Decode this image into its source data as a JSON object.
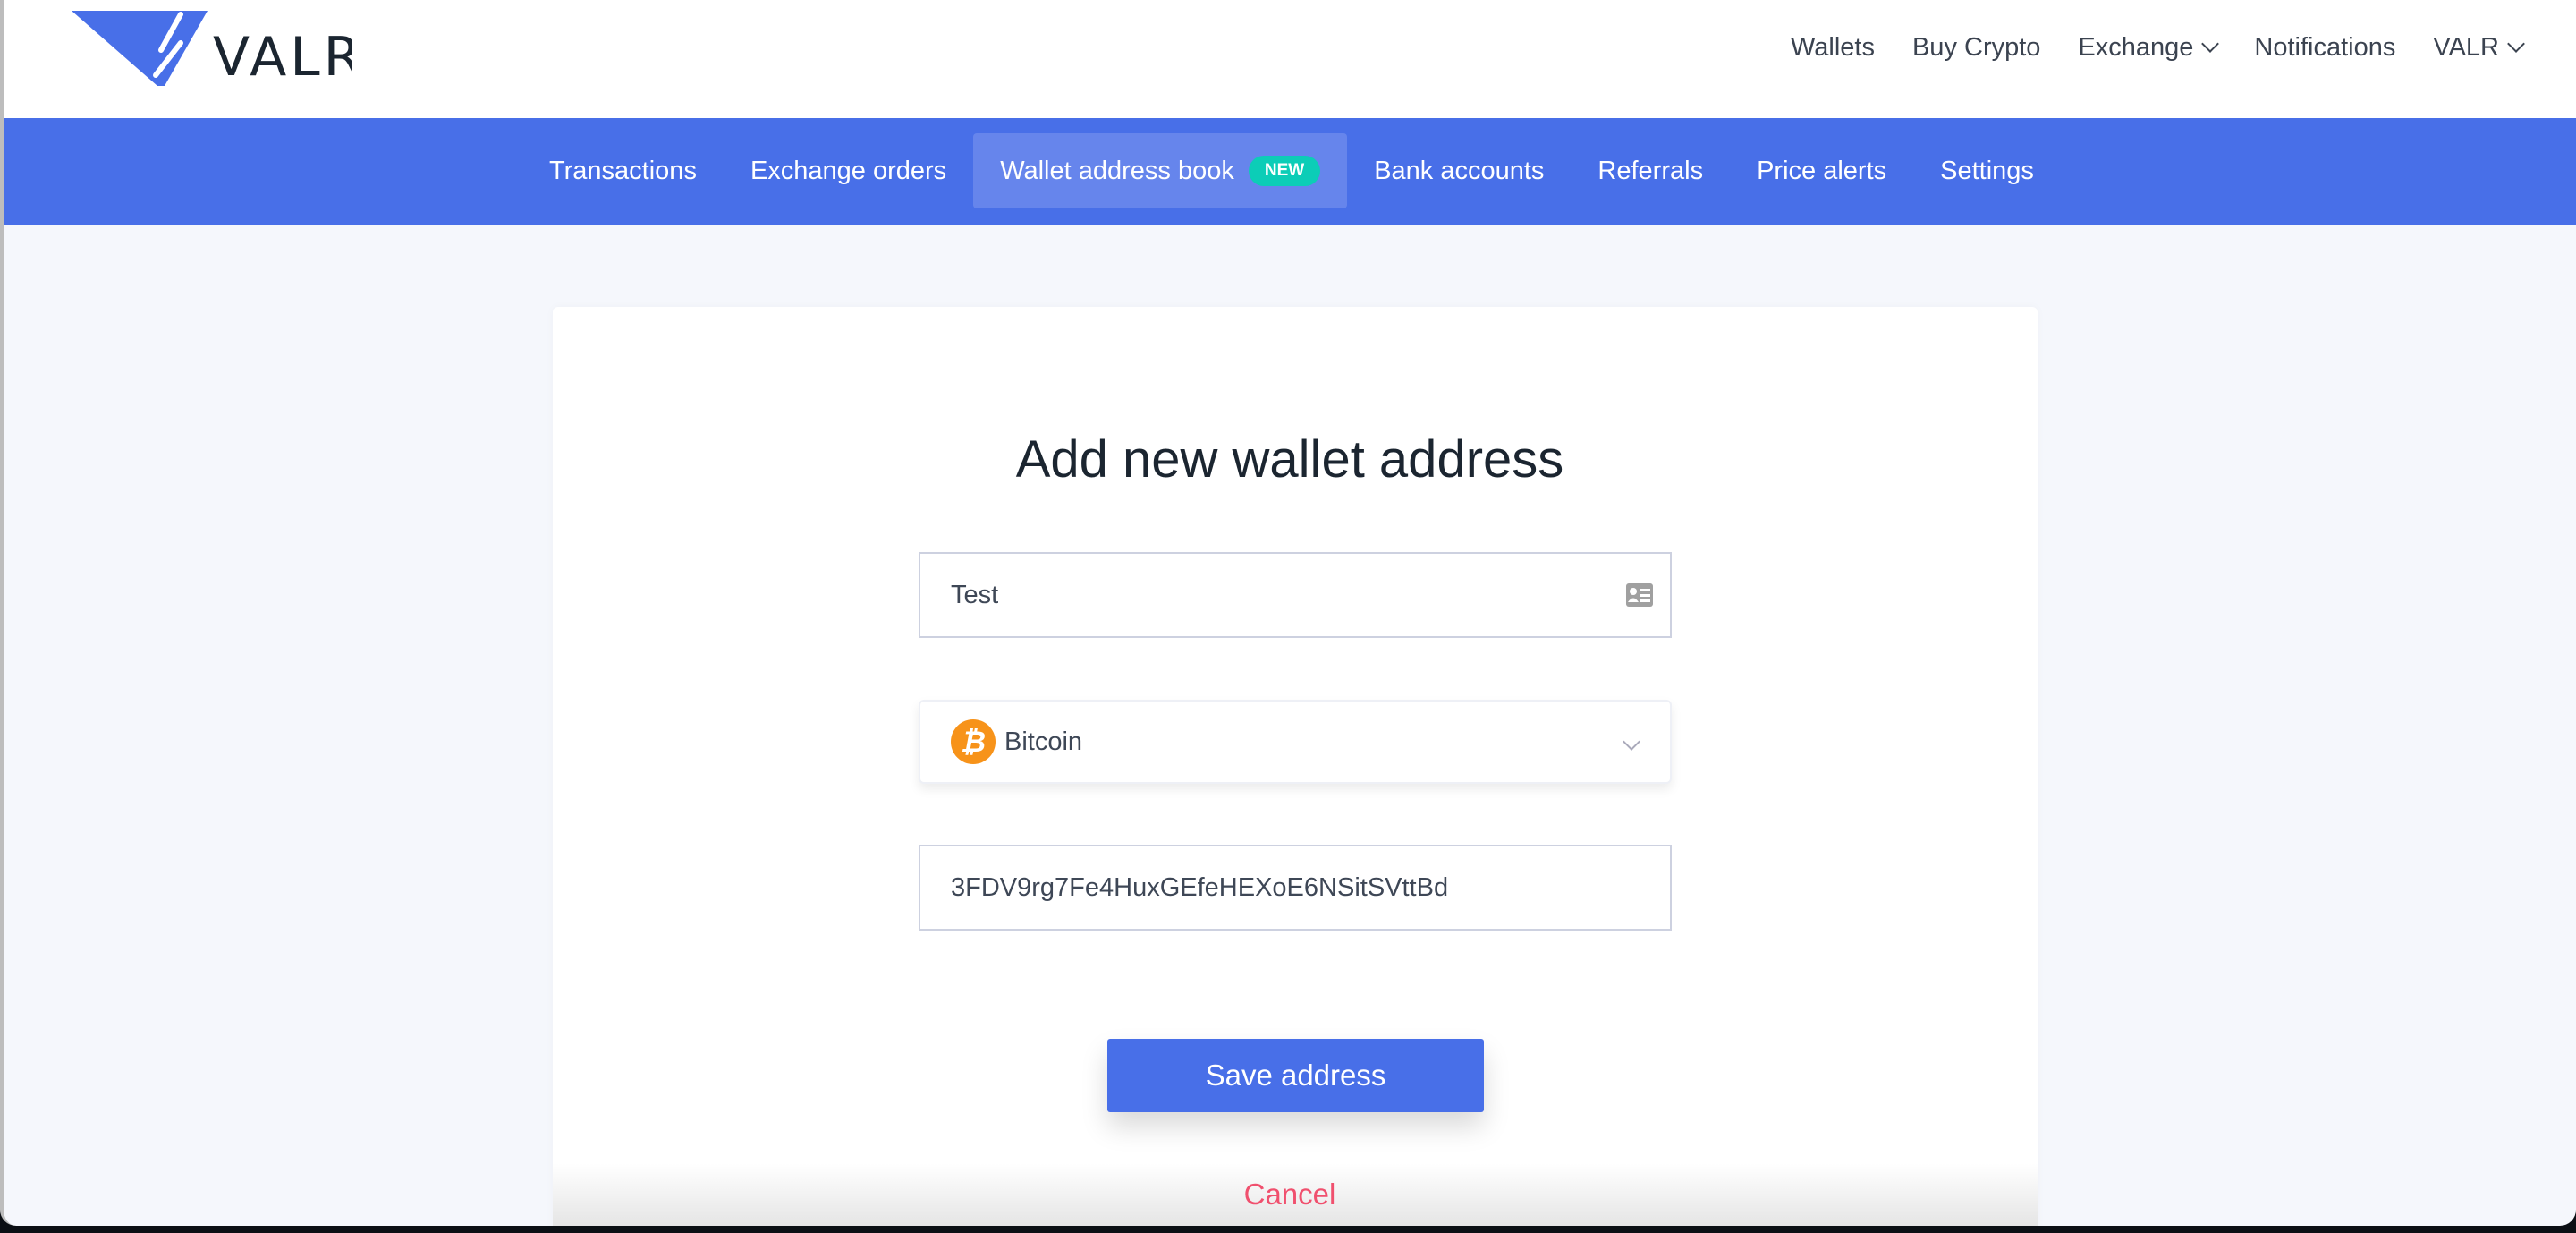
{
  "brand": {
    "name": "VALR",
    "color": "#486fe8"
  },
  "topnav": {
    "items": [
      {
        "label": "Wallets"
      },
      {
        "label": "Buy Crypto"
      },
      {
        "label": "Exchange",
        "dropdown": true
      },
      {
        "label": "Notifications"
      },
      {
        "label": "VALR",
        "dropdown": true
      }
    ]
  },
  "subnav": {
    "items": [
      {
        "label": "Transactions"
      },
      {
        "label": "Exchange orders"
      },
      {
        "label": "Wallet address book",
        "badge": "NEW",
        "active": true
      },
      {
        "label": "Bank accounts"
      },
      {
        "label": "Referrals"
      },
      {
        "label": "Price alerts"
      },
      {
        "label": "Settings"
      }
    ]
  },
  "form": {
    "title": "Add new wallet address",
    "label_value": "Test",
    "currency": {
      "label": "Bitcoin",
      "icon": "bitcoin-icon",
      "color": "#f7931a"
    },
    "address_value": "3FDV9rg7Fe4HuxGEfeHEXoE6NSitSVttBd",
    "save_label": "Save address",
    "cancel_label": "Cancel"
  }
}
